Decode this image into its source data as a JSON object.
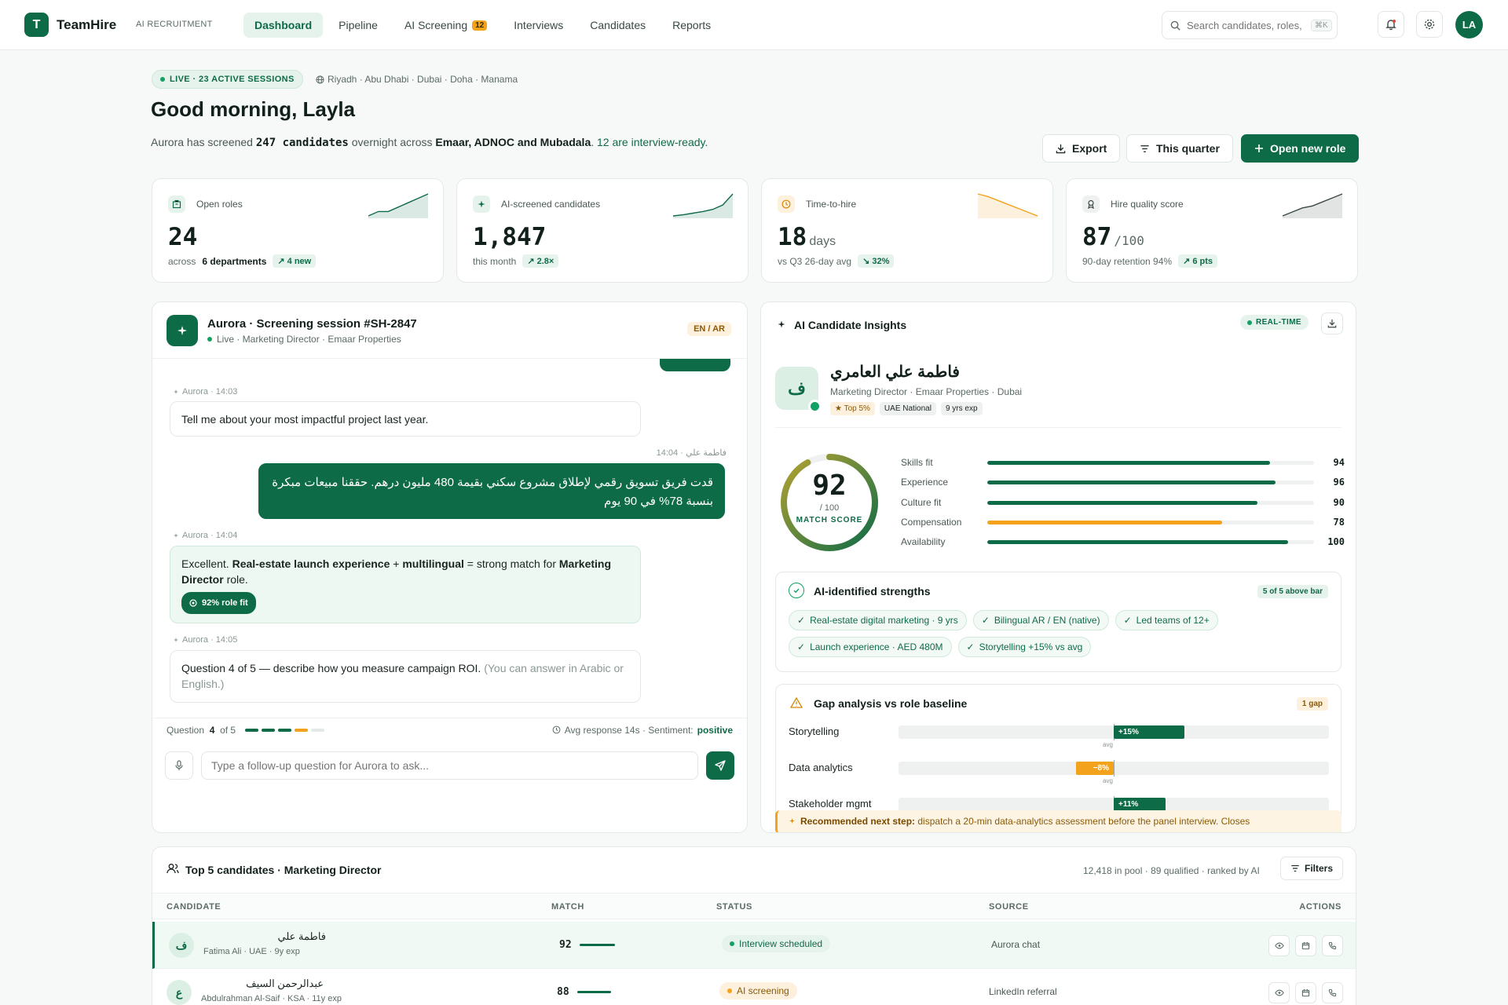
{
  "app": {
    "name": "TeamHire",
    "tagline": "AI RECRUITMENT",
    "logo_letter": "T"
  },
  "nav": [
    {
      "label": "Dashboard",
      "active": true
    },
    {
      "label": "Pipeline"
    },
    {
      "label": "AI Screening",
      "badge": "12"
    },
    {
      "label": "Interviews"
    },
    {
      "label": "Candidates"
    },
    {
      "label": "Reports"
    }
  ],
  "search": {
    "placeholder": "Search candidates, roles, sk",
    "shortcut": "⌘K"
  },
  "user": {
    "initials": "LA"
  },
  "header": {
    "live_label": "LIVE · 23 ACTIVE SESSIONS",
    "cities": "Riyadh · Abu Dhabi · Dubai · Doha · Manama",
    "greeting": "Good morning, Layla",
    "sub_pre": "Aurora has screened ",
    "sub_count": "247 candidates",
    "sub_mid": " overnight across ",
    "sub_companies": "Emaar, ADNOC and Mubadala",
    "sub_dot": ". ",
    "sub_ready": "12 are interview-ready."
  },
  "actions": {
    "export": "Export",
    "period": "This quarter",
    "new_role": "Open new role"
  },
  "kpis": [
    {
      "label": "Open roles",
      "value": "24",
      "unit": "",
      "foot_pre": "across",
      "foot_bold": "6 departments",
      "delta": "↗ 4 new",
      "icon": "building-icon",
      "trend": [
        3,
        4,
        4,
        5,
        6,
        7,
        8
      ]
    },
    {
      "label": "AI-screened candidates",
      "value": "1,847",
      "unit": "",
      "foot_pre": "this month",
      "foot_bold": "",
      "delta": "↗ 2.8×",
      "icon": "sparkle-icon",
      "trend": [
        1,
        1.2,
        1.5,
        1.8,
        2.2,
        3,
        5
      ]
    },
    {
      "label": "Time-to-hire",
      "value": "18",
      "unit": "days",
      "foot_pre": "vs Q3 26-day avg",
      "foot_bold": "",
      "delta": "↘ 32%",
      "icon": "clock-icon",
      "trend": [
        8,
        7.6,
        7,
        6.4,
        5.8,
        5.2,
        4.6
      ]
    },
    {
      "label": "Hire quality score",
      "value": "87",
      "unit": "/100",
      "foot_pre": "90-day retention 94%",
      "foot_bold": "",
      "delta": "↗ 6 pts",
      "icon": "award-icon",
      "trend": [
        2,
        3,
        4,
        4.5,
        5.5,
        6.5,
        7.5
      ]
    }
  ],
  "chat": {
    "title": "Aurora · Screening session #SH-2847",
    "subtitle": "Live · Marketing Director · Emaar Properties",
    "lang": "EN / AR",
    "messages": [
      {
        "meta": "Aurora · 14:03",
        "text": "Tell me about your most impactful project last year."
      },
      {
        "meta": "14:04 · فاطمة علي",
        "text": "قدت فريق تسويق رقمي لإطلاق مشروع سكني بقيمة 480 مليون درهم. حققنا مبيعات مبكرة بنسبة 78% في 90 يوم"
      },
      {
        "meta": "Aurora · 14:04",
        "t1": "Excellent. ",
        "b1": "Real-estate launch experience",
        "t2": " + ",
        "b2": "multilingual",
        "t3": " = strong match for ",
        "b3": "Marketing Director",
        "t4": " role.",
        "chip": "92% role fit"
      },
      {
        "meta": "Aurora · 14:05",
        "text": "Question 4 of 5 — describe how you measure campaign ROI.",
        "note": " (You can answer in Arabic or English.)"
      }
    ],
    "question_label": "Question",
    "question_num": "4",
    "question_of": "of 5",
    "progress": {
      "done": 3,
      "current": 1,
      "total": 5
    },
    "avg": "Avg response 14s · Sentiment:",
    "sentiment": "positive",
    "input_placeholder": "Type a follow-up question for Aurora to ask..."
  },
  "insights": {
    "title": "AI Candidate Insights",
    "realtime": "REAL-TIME",
    "candidate": {
      "initial": "ف",
      "name": "فاطمة علي العامري",
      "role": "Marketing Director · Emaar Properties · Dubai",
      "tags": [
        "★ Top 5%",
        "UAE National",
        "9 yrs exp"
      ]
    },
    "score": 92,
    "score_sub": "/ 100",
    "score_label": "MATCH SCORE",
    "fits": [
      {
        "name": "Skills fit",
        "value": 94
      },
      {
        "name": "Experience",
        "value": 96
      },
      {
        "name": "Culture fit",
        "value": 90
      },
      {
        "name": "Compensation",
        "value": 78,
        "warn": true
      },
      {
        "name": "Availability",
        "value": 100
      }
    ],
    "strengths_title": "AI-identified strengths",
    "strengths_badge": "5 of 5 above bar",
    "strengths": [
      "Real-estate digital marketing · 9 yrs",
      "Bilingual AR / EN (native)",
      "Led teams of 12+",
      "Launch experience · AED 480M",
      "Storytelling +15% vs avg"
    ],
    "gap_title": "Gap analysis vs role baseline",
    "gap_badge": "1 gap",
    "gaps": [
      {
        "name": "Storytelling",
        "delta": 15,
        "label": "+15%"
      },
      {
        "name": "Data analytics",
        "delta": -8,
        "label": "−8%"
      },
      {
        "name": "Stakeholder mgmt",
        "delta": 11,
        "label": "+11%"
      }
    ],
    "avg_label": "avg",
    "recommend_bold": "Recommended next step:",
    "recommend_text": " dispatch a 20-min data-analytics assessment before the panel interview. Closes"
  },
  "table": {
    "title": "Top 5 candidates · Marketing Director",
    "meta": "12,418 in pool · 89 qualified · ranked by AI",
    "filters": "Filters",
    "headers": {
      "candidate": "CANDIDATE",
      "match": "MATCH",
      "status": "STATUS",
      "source": "SOURCE",
      "actions": "ACTIONS"
    },
    "rows": [
      {
        "initial": "ف",
        "name_ar": "فاطمة علي",
        "name_en": "Fatima Ali · UAE · 9y exp",
        "match": "92",
        "match_val": 92,
        "status": "Interview scheduled",
        "status_type": "green",
        "source": "Aurora chat"
      },
      {
        "initial": "ع",
        "name_ar": "عبدالرحمن السيف",
        "name_en": "Abdulrahman Al-Saif · KSA · 11y exp",
        "match": "88",
        "match_val": 88,
        "status": "AI screening",
        "status_type": "amber",
        "source": "LinkedIn referral"
      }
    ]
  }
}
